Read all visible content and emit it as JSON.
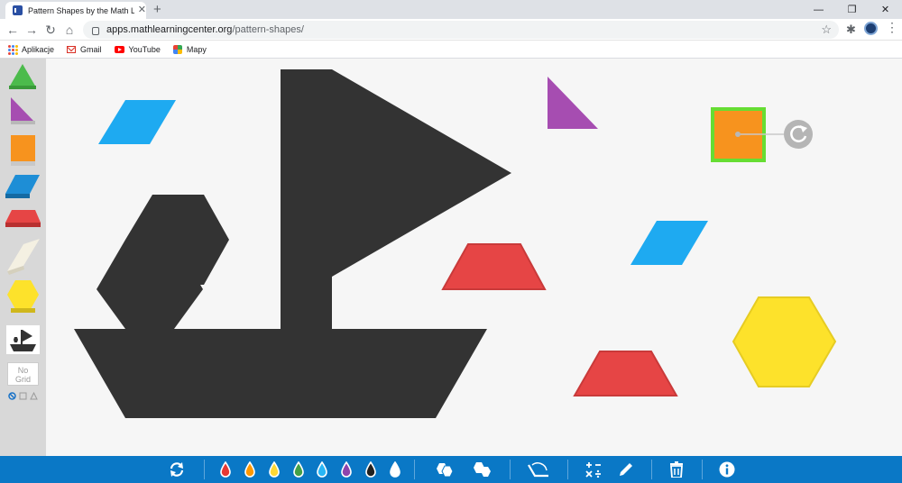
{
  "browser": {
    "tab_title": "Pattern Shapes by the Math Lear",
    "new_tab_symbol": "+",
    "url_host": "apps.mathlearningcenter.org",
    "url_path": "/pattern-shapes/",
    "bookmarks": [
      "Aplikacje",
      "Gmail",
      "YouTube",
      "Mapy"
    ]
  },
  "left_panel": {
    "no_grid_line1": "No",
    "no_grid_line2": "Grid",
    "shapes": [
      "green-triangle",
      "purple-triangle",
      "orange-square",
      "blue-rhombus",
      "red-trapezoid",
      "tan-rhombus",
      "yellow-hexagon",
      "boat-template"
    ]
  },
  "canvas": {
    "silhouette_color": "#333333",
    "selected_outline_color": "#66dd33",
    "pieces": [
      {
        "shape": "blue-rhombus",
        "color": "#1eaaf1"
      },
      {
        "shape": "purple-triangle",
        "color": "#a64db1"
      },
      {
        "shape": "orange-square",
        "color": "#f7931e",
        "selected": true
      },
      {
        "shape": "blue-rhombus",
        "color": "#1eaaf1"
      },
      {
        "shape": "red-trapezoid",
        "color": "#e64545"
      },
      {
        "shape": "red-trapezoid",
        "color": "#e64545"
      },
      {
        "shape": "yellow-hexagon",
        "color": "#fde22b"
      }
    ]
  },
  "bottom_toolbar": {
    "background": "#0a78c6",
    "color_drops": [
      "#e53935",
      "#ff9800",
      "#fdd835",
      "#43a047",
      "#29b6f6",
      "#8e44ad",
      "#212121",
      "#ffffff"
    ],
    "tools": [
      "rotate-icon",
      "color-drops",
      "group-shapes-icon",
      "ungroup-shapes-icon",
      "measure-angle-icon",
      "math-operations-icon",
      "pencil-icon",
      "trash-icon",
      "info-icon"
    ]
  }
}
